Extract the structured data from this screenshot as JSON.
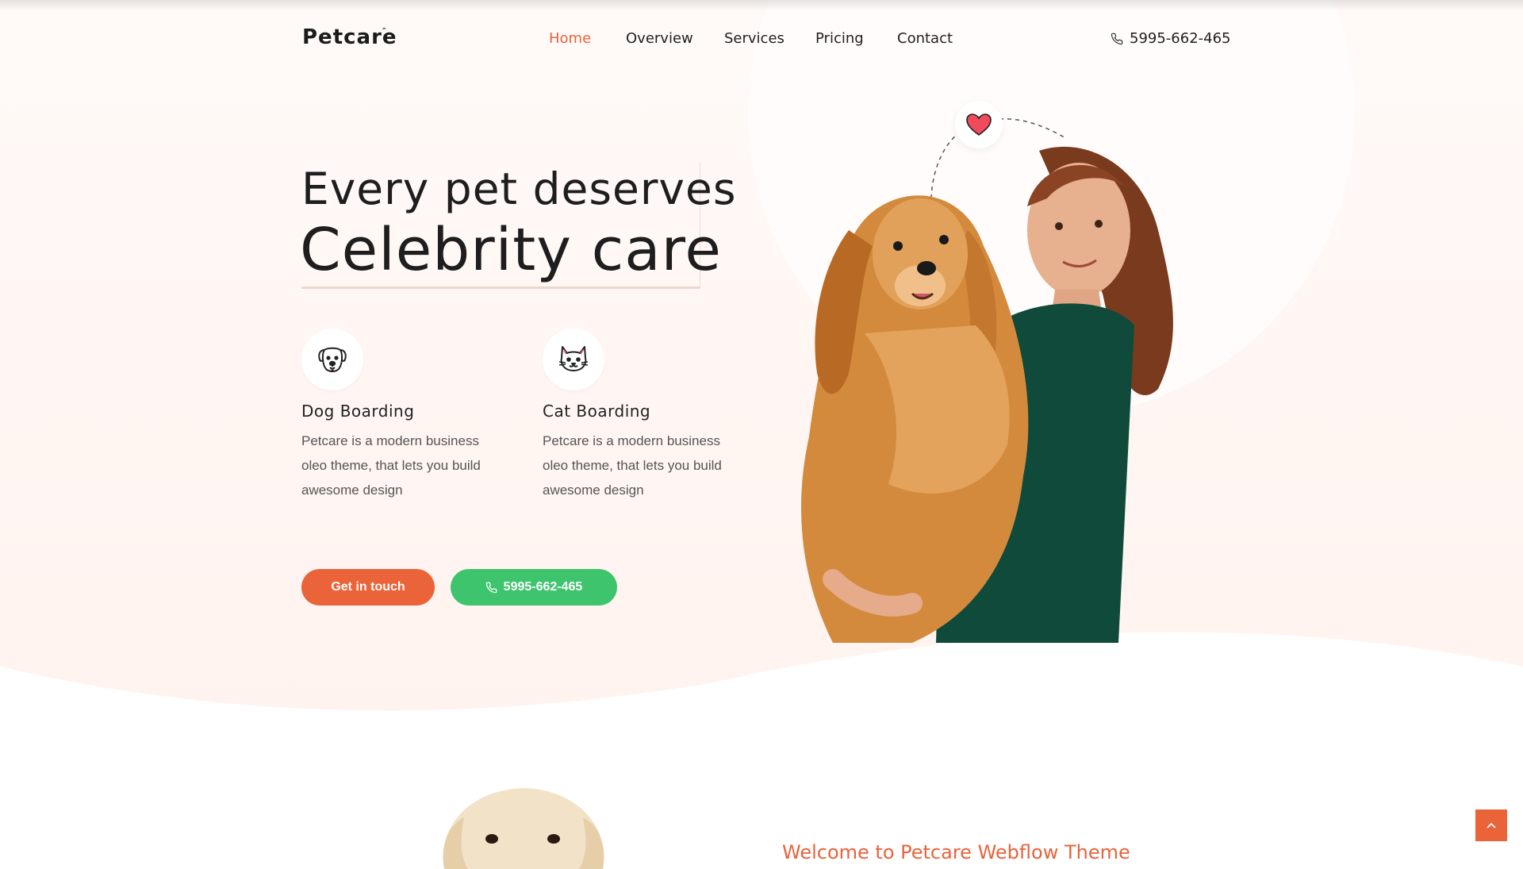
{
  "brand": {
    "name": "Petcare",
    "mark": "ˆ"
  },
  "nav": [
    {
      "label": "Home",
      "active": true
    },
    {
      "label": "Overview",
      "active": false
    },
    {
      "label": "Services",
      "active": false
    },
    {
      "label": "Pricing",
      "active": false
    },
    {
      "label": "Contact",
      "active": false
    }
  ],
  "header": {
    "phone": "5995-662-465",
    "phone_icon": "phone-icon"
  },
  "hero": {
    "title_line1": "Every pet deserves",
    "title_line2": "Celebrity care",
    "features": [
      {
        "icon": "dog-icon",
        "title": "Dog Boarding",
        "text": "Petcare is a modern business oleo theme, that lets you build awesome design"
      },
      {
        "icon": "cat-icon",
        "title": "Cat Boarding",
        "text": "Petcare is a modern business oleo theme, that lets you build awesome design"
      }
    ],
    "cta_primary": "Get in touch",
    "cta_phone": "5995-662-465",
    "heart_icon": "heart-icon"
  },
  "section2": {
    "heading": "Welcome to Petcare Webflow Theme"
  },
  "colors": {
    "accent": "#eb6338",
    "green": "#3ec46d",
    "text": "#1e1e1e",
    "hero_bg": "#fff5f1"
  },
  "back_to_top_icon": "chevron-up-icon"
}
